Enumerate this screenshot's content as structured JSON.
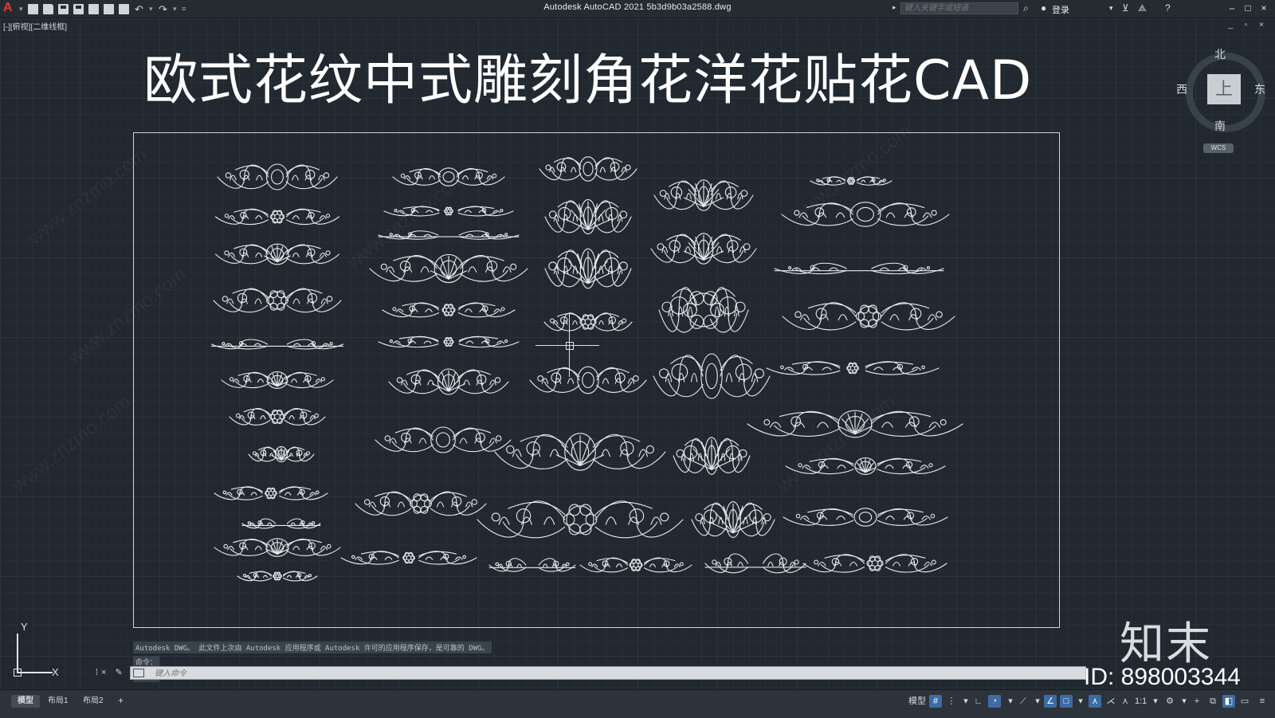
{
  "app": {
    "title": "Autodesk AutoCAD 2021    5b3d9b03a2588.dwg",
    "logo": "A",
    "search_placeholder": "键入关键字或短语",
    "login": "登录"
  },
  "viewport": {
    "view_label": "[-][俯视][二维线框]",
    "controls": "_ ▫ ×",
    "drawing_title": "欧式花纹中式雕刻角花洋花贴花CAD",
    "viewcube": {
      "north": "北",
      "south": "南",
      "west": "西",
      "east": "东",
      "face": "上",
      "wcs": "WCS"
    },
    "ucs": {
      "x": "X",
      "y": "Y"
    }
  },
  "command": {
    "history": [
      "Autodesk DWG。 此文件上次由 Autodesk 应用程序或 Autodesk 许可的应用程序保存，是可靠的 DWG。",
      "命令：",
      "命令："
    ],
    "placeholder": "键入命令"
  },
  "watermark": {
    "text": "www.znzmo.com",
    "cn": "知末网",
    "brand": "知末",
    "id": "ID: 898003344"
  },
  "statusbar": {
    "tabs": [
      "模型",
      "布局1",
      "布局2"
    ],
    "add": "+",
    "model_label": "模型",
    "scale": "1:1"
  },
  "colors": {
    "background": "#212830",
    "linework": "#e8ebee",
    "accent": "#3d6ba5"
  }
}
